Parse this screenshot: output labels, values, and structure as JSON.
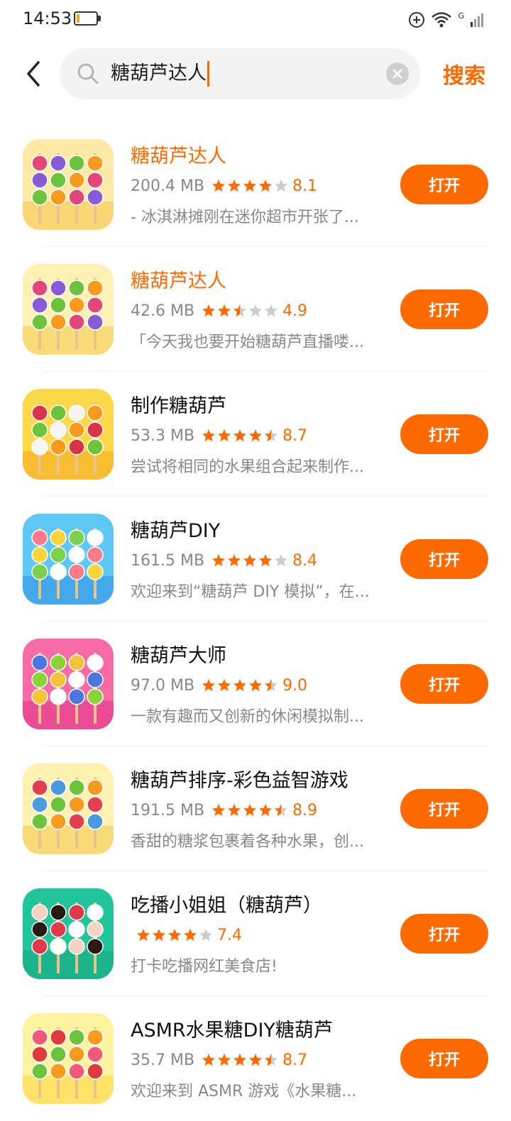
{
  "status_bar": {
    "time": "14:53",
    "battery_level": 0.15,
    "battery_color": "#f3a21a",
    "network_label": "G"
  },
  "search": {
    "query": "糖葫芦达人",
    "button_label": "搜索"
  },
  "colors": {
    "accent": "#ff6a00",
    "star_empty": "#cccccc"
  },
  "results": [
    {
      "name": "糖葫芦达人",
      "highlight": true,
      "size": "200.4 MB",
      "stars": 4,
      "rating": "8.1",
      "desc": "- 冰淇淋摊刚在迷你超市开张了...",
      "button": "打开",
      "icon": "candied-fruit-skewers-icon",
      "icon_colors": [
        "#ffe9a6",
        "#f6c84a",
        "#e5467a",
        "#8a5bd6",
        "#6cc43c",
        "#f79a1e"
      ]
    },
    {
      "name": "糖葫芦达人",
      "highlight": true,
      "size": "42.6 MB",
      "stars": 2.5,
      "rating": "4.9",
      "desc": "「今天我也要开始糖葫芦直播喽...",
      "button": "打开",
      "icon": "candied-fruit-skewers-icon",
      "icon_colors": [
        "#fff1b3",
        "#f6c84a",
        "#e5467a",
        "#8a5bd6",
        "#6cc43c",
        "#f79a1e"
      ]
    },
    {
      "name": "制作糖葫芦",
      "highlight": false,
      "size": "53.3 MB",
      "stars": 4.5,
      "rating": "8.7",
      "desc": "尝试将相同的水果组合起来制作...",
      "button": "打开",
      "icon": "fruit-candy-icon",
      "icon_colors": [
        "#ffd84a",
        "#f2a81c",
        "#d9334a",
        "#6cc43c",
        "#f5f5f5",
        "#f79a1e"
      ]
    },
    {
      "name": "糖葫芦DIY",
      "highlight": false,
      "size": "161.5 MB",
      "stars": 4,
      "rating": "8.4",
      "desc": "欢迎来到“糖葫芦 DIY 模拟”，在...",
      "button": "打开",
      "icon": "cartoon-girl-skewers-icon",
      "icon_colors": [
        "#5ec8f5",
        "#2f8fe0",
        "#ff7b8a",
        "#ffd43a",
        "#7bd24a",
        "#ffffff"
      ]
    },
    {
      "name": "糖葫芦大师",
      "highlight": false,
      "size": "97.0 MB",
      "stars": 4.5,
      "rating": "9.0",
      "desc": "一款有趣而又创新的休闲模拟制...",
      "button": "打开",
      "icon": "fruit-faces-skewers-icon",
      "icon_colors": [
        "#f66aa5",
        "#e0338a",
        "#4a78e0",
        "#8ad43a",
        "#f5c33a",
        "#ffffff"
      ]
    },
    {
      "name": "糖葫芦排序-彩色益智游戏",
      "highlight": false,
      "size": "191.5 MB",
      "stars": 4.5,
      "rating": "8.9",
      "desc": "香甜的糖浆包裹着各种水果，创...",
      "button": "打开",
      "icon": "sorting-skewers-icon",
      "icon_colors": [
        "#fff2b0",
        "#f2c94a",
        "#e04050",
        "#4a9ae0",
        "#6cc43c",
        "#f79a1e"
      ]
    },
    {
      "name": "吃播小姐姐（糖葫芦）",
      "highlight": false,
      "size": "",
      "stars": 4,
      "rating": "7.4",
      "desc": "打卡吃播网红美食店!",
      "button": "打开",
      "icon": "eating-girl-icon",
      "icon_colors": [
        "#22c49a",
        "#16a882",
        "#f6d2c0",
        "#2a1a14",
        "#e03a4a",
        "#ffffff"
      ]
    },
    {
      "name": "ASMR水果糖DIY糖葫芦",
      "highlight": false,
      "size": "35.7 MB",
      "stars": 4.5,
      "rating": "8.7",
      "desc": "欢迎来到 ASMR 游戏《水果糖...",
      "button": "打开",
      "icon": "asmr-candy-girl-icon",
      "icon_colors": [
        "#fff3a0",
        "#ffd43a",
        "#f05a7a",
        "#e03a3a",
        "#6cc43c",
        "#f79a1e"
      ]
    }
  ]
}
